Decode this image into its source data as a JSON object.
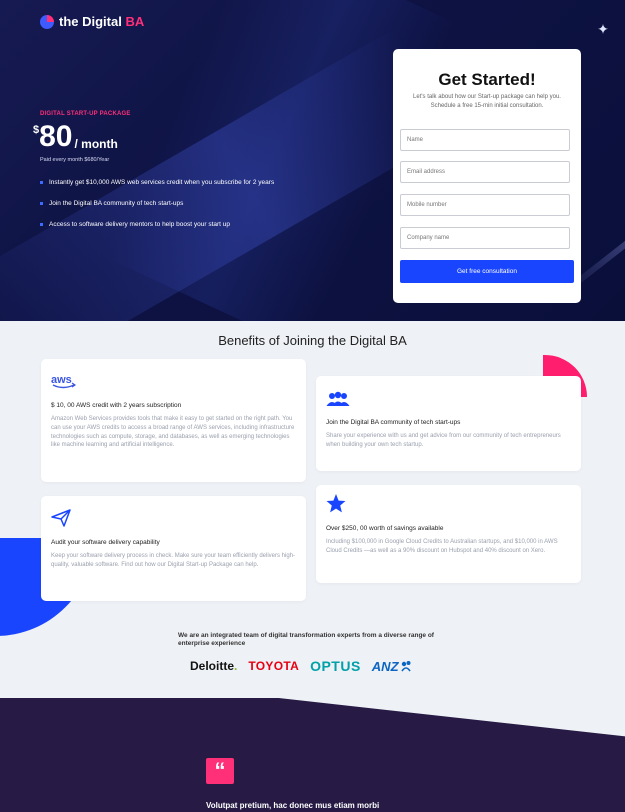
{
  "brand": {
    "name_prefix": "the Digital ",
    "name_suffix": "BA"
  },
  "hero": {
    "package_tag": "DIGITAL START-UP PACKAGE",
    "currency": "$",
    "amount": "80",
    "period": "/ month",
    "price_note": "Paid every month $680/Year",
    "features": [
      "Instantly get $10,000 AWS web services credit when you subscribe for 2 years",
      "Join the Digital BA community of tech start-ups",
      "Access to software delivery mentors to help boost your start up"
    ]
  },
  "form": {
    "title": "Get Started!",
    "subtitle": "Let's talk about how our Start-up package can help you. Schedule a free 15-min initial consultation.",
    "name_placeholder": "Name",
    "email_placeholder": "Email address",
    "mobile_placeholder": "Mobile number",
    "company_placeholder": "Company name",
    "submit_label": "Get free consultation"
  },
  "benefits": {
    "title": "Benefits of Joining the Digital BA",
    "cards": [
      {
        "icon": "aws-logo-icon",
        "icon_text": "aws",
        "title": "$ 10, 00 AWS credit with 2 years subscription",
        "body": "Amazon Web Services provides tools that make it easy to get started on the right path. You can use your AWS credits to access a broad range of AWS services, including infrastructure technologies such as compute, storage, and databases, as well as emerging technologies like machine learning and artificial intelligence."
      },
      {
        "icon": "community-icon",
        "title": "Join the Digital BA community of tech start-ups",
        "body": "Share your experience with us and get advice from our community of tech entrepreneurs when building your own tech startup."
      },
      {
        "icon": "paper-plane-icon",
        "title": "Audit your software delivery capability",
        "body": "Keep your software delivery process in check. Make sure your team efficiently delivers high-quality, valuable software. Find out how our Digital Start-up Package can help."
      },
      {
        "icon": "star-icon",
        "title": "Over $250, 00 worth of savings available",
        "body": "Including $100,000 in Google Cloud Credits to Australian startups, and $10,000 in AWS Cloud Credits —as well as a 90% discount on Hubspot and 40% discount on Xero."
      }
    ]
  },
  "trust": {
    "text": "We are an integrated team of digital transformation experts from a diverse range of enterprise experience",
    "brands": [
      "Deloitte",
      "TOYOTA",
      "OPTUS",
      "ANZ"
    ]
  },
  "testimonial": {
    "quote_mark": "“",
    "text": "Volutpat pretium, hac donec mus etiam morbi"
  },
  "colors": {
    "hero_bg": "#0e1344",
    "accent_pink": "#ff2f78",
    "accent_blue": "#1a45ff",
    "page_bg": "#eef1f5",
    "footer_bg": "#271b45"
  }
}
